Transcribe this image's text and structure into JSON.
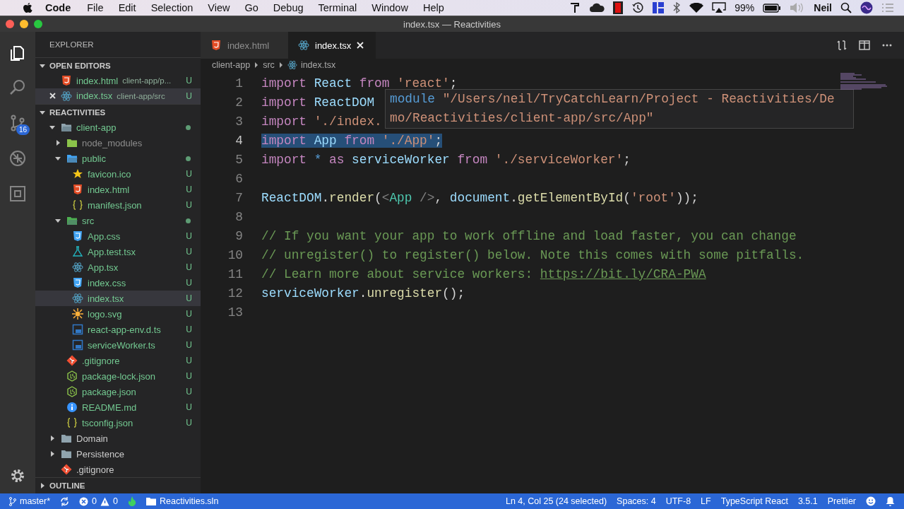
{
  "menubar": {
    "app": "Code",
    "menus": [
      "File",
      "Edit",
      "Selection",
      "View",
      "Go",
      "Debug",
      "Terminal",
      "Window",
      "Help"
    ],
    "battery": "99%",
    "user": "Neil"
  },
  "window": {
    "title": "index.tsx — Reactivities"
  },
  "activity_bar": {
    "items": [
      {
        "selected": true
      },
      {
        "selected": false
      },
      {
        "selected": false,
        "badge": "16"
      },
      {
        "selected": false
      },
      {
        "selected": false
      }
    ]
  },
  "sidebar": {
    "title": "EXPLORER",
    "open_editors": {
      "title": "OPEN EDITORS",
      "expanded": true,
      "items": [
        {
          "kind": "html",
          "name": "index.html",
          "path": "client-app/p...",
          "badge": "U",
          "selected": false
        },
        {
          "kind": "react",
          "name": "index.tsx",
          "path": "client-app/src",
          "badge": "U",
          "selected": true
        }
      ]
    },
    "project": {
      "title": "REACTIVITIES",
      "expanded": true,
      "items": [
        {
          "kind": "folder",
          "name": "client-app",
          "color": "#73c991",
          "dot": true,
          "expanded": true,
          "selected": false,
          "children": [
            {
              "kind": "folder-node",
              "name": "node_modules",
              "color": "#8c8c8c",
              "expanded": false,
              "selected": false
            },
            {
              "kind": "folder-public",
              "name": "public",
              "color": "#73c991",
              "dot": true,
              "expanded": true,
              "selected": false,
              "children": [
                {
                  "kind": "star",
                  "name": "favicon.ico",
                  "color": "#73c991",
                  "badge": "U",
                  "selected": false
                },
                {
                  "kind": "html",
                  "name": "index.html",
                  "color": "#73c991",
                  "badge": "U",
                  "selected": false
                },
                {
                  "kind": "json",
                  "name": "manifest.json",
                  "color": "#73c991",
                  "badge": "U",
                  "selected": false
                }
              ]
            },
            {
              "kind": "folder-src",
              "name": "src",
              "color": "#73c991",
              "dot": true,
              "expanded": true,
              "selected": false,
              "children": [
                {
                  "kind": "css",
                  "name": "App.css",
                  "color": "#73c991",
                  "badge": "U",
                  "selected": false
                },
                {
                  "kind": "test",
                  "name": "App.test.tsx",
                  "color": "#73c991",
                  "badge": "U",
                  "selected": false
                },
                {
                  "kind": "react",
                  "name": "App.tsx",
                  "color": "#73c991",
                  "badge": "U",
                  "selected": false
                },
                {
                  "kind": "css",
                  "name": "index.css",
                  "color": "#73c991",
                  "badge": "U",
                  "selected": false
                },
                {
                  "kind": "react",
                  "name": "index.tsx",
                  "color": "#73c991",
                  "badge": "U",
                  "selected": true
                },
                {
                  "kind": "svg",
                  "name": "logo.svg",
                  "color": "#73c991",
                  "badge": "U",
                  "selected": false
                },
                {
                  "kind": "ts",
                  "name": "react-app-env.d.ts",
                  "color": "#73c991",
                  "badge": "U",
                  "selected": false
                },
                {
                  "kind": "ts",
                  "name": "serviceWorker.ts",
                  "color": "#73c991",
                  "badge": "U",
                  "selected": false
                }
              ]
            },
            {
              "kind": "git",
              "name": ".gitignore",
              "color": "#73c991",
              "badge": "U",
              "selected": false
            },
            {
              "kind": "npm",
              "name": "package-lock.json",
              "color": "#73c991",
              "badge": "U",
              "selected": false
            },
            {
              "kind": "npm",
              "name": "package.json",
              "color": "#73c991",
              "badge": "U",
              "selected": false
            },
            {
              "kind": "info",
              "name": "README.md",
              "color": "#73c991",
              "badge": "U",
              "selected": false
            },
            {
              "kind": "json",
              "name": "tsconfig.json",
              "color": "#73c991",
              "badge": "U",
              "selected": false
            }
          ]
        },
        {
          "kind": "folder",
          "name": "Domain",
          "color": "#cccccc",
          "expanded": false,
          "selected": false
        },
        {
          "kind": "folder",
          "name": "Persistence",
          "color": "#cccccc",
          "expanded": false,
          "selected": false
        },
        {
          "kind": "git",
          "name": ".gitignore",
          "color": "#cccccc",
          "selected": false
        }
      ]
    },
    "outline": {
      "title": "OUTLINE",
      "expanded": false
    }
  },
  "tabs": [
    {
      "kind": "html",
      "label": "index.html",
      "selected": false
    },
    {
      "kind": "react",
      "label": "index.tsx",
      "selected": true
    }
  ],
  "breadcrumbs": [
    {
      "label": "client-app"
    },
    {
      "label": "src"
    },
    {
      "label": "index.tsx",
      "kind": "react"
    }
  ],
  "editor": {
    "lines": [
      {
        "number": "1",
        "selected": false,
        "tokens": [
          {
            "kind": "kw",
            "text": "import "
          },
          {
            "kind": "id",
            "text": "React "
          },
          {
            "kind": "kw",
            "text": "from "
          },
          {
            "kind": "str",
            "text": "'react'"
          },
          {
            "kind": "pl",
            "text": ";"
          }
        ]
      },
      {
        "number": "2",
        "selected": false,
        "tokens": [
          {
            "kind": "kw",
            "text": "import "
          },
          {
            "kind": "id",
            "text": "ReactDOM "
          }
        ]
      },
      {
        "number": "3",
        "selected": false,
        "tokens": [
          {
            "kind": "kw",
            "text": "import "
          },
          {
            "kind": "str",
            "text": "'./index."
          }
        ]
      },
      {
        "number": "4",
        "selected": true,
        "tokens": [
          {
            "kind": "kw",
            "text": "import "
          },
          {
            "kind": "id",
            "text": "App "
          },
          {
            "kind": "kw",
            "text": "from "
          },
          {
            "kind": "str",
            "text": "'./App'"
          },
          {
            "kind": "pl",
            "text": ";"
          }
        ]
      },
      {
        "number": "5",
        "selected": false,
        "tokens": [
          {
            "kind": "kw",
            "text": "import "
          },
          {
            "kind": "op",
            "text": "* "
          },
          {
            "kind": "kw",
            "text": "as "
          },
          {
            "kind": "id",
            "text": "serviceWorker "
          },
          {
            "kind": "kw",
            "text": "from "
          },
          {
            "kind": "str",
            "text": "'./serviceWorker'"
          },
          {
            "kind": "pl",
            "text": ";"
          }
        ]
      },
      {
        "number": "6",
        "selected": false
      },
      {
        "number": "7",
        "selected": false,
        "tokens": [
          {
            "kind": "id",
            "text": "ReactDOM"
          },
          {
            "kind": "pl",
            "text": "."
          },
          {
            "kind": "fn",
            "text": "render"
          },
          {
            "kind": "pl",
            "text": "("
          },
          {
            "kind": "tag",
            "text": "<"
          },
          {
            "kind": "type",
            "text": "App"
          },
          {
            "kind": "tag",
            "text": " />"
          },
          {
            "kind": "pl",
            "text": ", "
          },
          {
            "kind": "id",
            "text": "document"
          },
          {
            "kind": "pl",
            "text": "."
          },
          {
            "kind": "fn",
            "text": "getElementById"
          },
          {
            "kind": "pl",
            "text": "("
          },
          {
            "kind": "str",
            "text": "'root'"
          },
          {
            "kind": "pl",
            "text": "));"
          }
        ]
      },
      {
        "number": "8",
        "selected": false
      },
      {
        "number": "9",
        "selected": false,
        "tokens": [
          {
            "kind": "cm",
            "text": "// If you want your app to work offline and load faster, you can change"
          }
        ]
      },
      {
        "number": "10",
        "selected": false,
        "tokens": [
          {
            "kind": "cm",
            "text": "// unregister() to register() below. Note this comes with some pitfalls."
          }
        ]
      },
      {
        "number": "11",
        "selected": false,
        "tokens": [
          {
            "kind": "cm",
            "text": "// Learn more about service workers: "
          },
          {
            "kind": "link",
            "text": "https://bit.ly/CRA-PWA"
          }
        ]
      },
      {
        "number": "12",
        "selected": false,
        "tokens": [
          {
            "kind": "id",
            "text": "serviceWorker"
          },
          {
            "kind": "pl",
            "text": "."
          },
          {
            "kind": "fn",
            "text": "unregister"
          },
          {
            "kind": "pl",
            "text": "();"
          }
        ]
      },
      {
        "number": "13",
        "selected": false
      }
    ],
    "hover": {
      "keyword": "module",
      "lines": [
        "\"/Users/neil/TryCatchLearn/Project - Reactivities/De",
        "mo/Reactivities/client-app/src/App\""
      ]
    }
  },
  "status_bar": {
    "branch": "master*",
    "errors": "0",
    "warnings": "0",
    "solution": "Reactivities.sln",
    "position": "Ln 4, Col 25 (24 selected)",
    "indent": "Spaces: 4",
    "encoding": "UTF-8",
    "eol": "LF",
    "language": "TypeScript React",
    "version": "3.5.1",
    "formatter": "Prettier"
  }
}
